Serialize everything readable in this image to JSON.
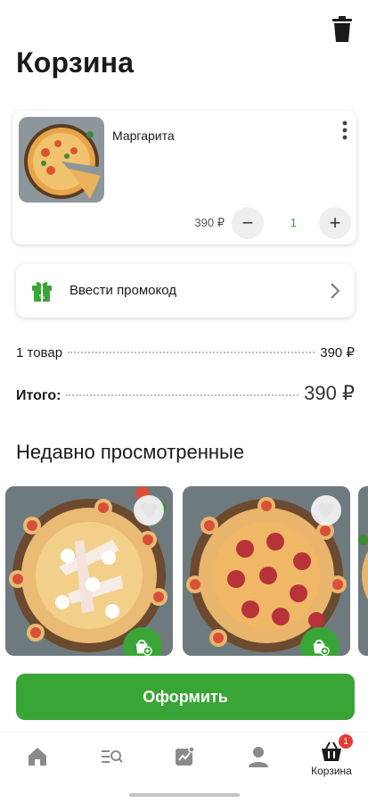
{
  "header": {
    "title": "Корзина",
    "trash_icon": "trash-icon"
  },
  "cart": {
    "items": [
      {
        "name": "Маргарита",
        "price": "390 ₽",
        "quantity": "1"
      }
    ],
    "minus_label": "−",
    "plus_label": "+"
  },
  "promo": {
    "label": "Ввести промокод",
    "icon": "gift-icon"
  },
  "summary": {
    "items_label": "1 товар",
    "items_price": "390 ₽",
    "total_label": "Итого:",
    "total_value": "390 ₽"
  },
  "recent": {
    "title": "Недавно просмотренные"
  },
  "checkout": {
    "label": "Оформить"
  },
  "tabbar": {
    "items": [
      {
        "icon": "home-icon",
        "label": ""
      },
      {
        "icon": "menu-search-icon",
        "label": ""
      },
      {
        "icon": "promo-chart-icon",
        "label": ""
      },
      {
        "icon": "profile-icon",
        "label": ""
      },
      {
        "icon": "basket-icon",
        "label": "Корзина",
        "badge": "1"
      }
    ]
  },
  "colors": {
    "accent": "#3aa537",
    "badge": "#e53935",
    "text": "#1a1a1a"
  }
}
